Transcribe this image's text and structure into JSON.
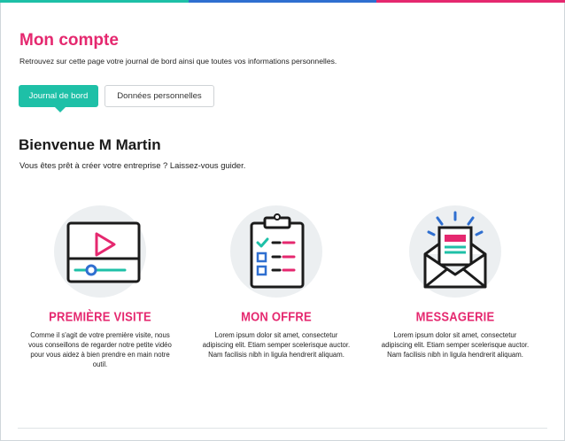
{
  "colors": {
    "accent_pink": "#e5286f",
    "accent_teal": "#1ec0a7",
    "accent_blue": "#2f6fd0",
    "top_stripe": [
      "#1ec0a7",
      "#2f6fd0",
      "#e5286f"
    ]
  },
  "header": {
    "title": "Mon compte",
    "subtitle": "Retrouvez sur cette page votre journal de bord  ainsi que toutes vos informations personnelles."
  },
  "tabs": [
    {
      "label": "Journal de bord",
      "active": true
    },
    {
      "label": "Données personnelles",
      "active": false
    }
  ],
  "welcome": {
    "title": "Bienvenue M Martin",
    "subtitle": "Vous êtes prêt à créer votre entreprise ? Laissez-vous guider."
  },
  "cards": [
    {
      "icon": "video-player-icon",
      "title": "PREMIÈRE VISITE",
      "text": "Comme il s'agit de votre première visite, nous vous conseillons de regarder notre petite vidéo pour vous aidez à bien prendre en main notre outil."
    },
    {
      "icon": "clipboard-checklist-icon",
      "title": "MON OFFRE",
      "text": "Lorem ipsum dolor sit amet, consectetur adipiscing elit. Etiam semper scelerisque auctor. Nam facilisis nibh in ligula hendrerit aliquam."
    },
    {
      "icon": "open-envelope-icon",
      "title": "MESSAGERIE",
      "text": "Lorem ipsum dolor sit amet, consectetur adipiscing elit. Etiam semper scelerisque auctor. Nam facilisis nibh in ligula hendrerit aliquam."
    }
  ]
}
